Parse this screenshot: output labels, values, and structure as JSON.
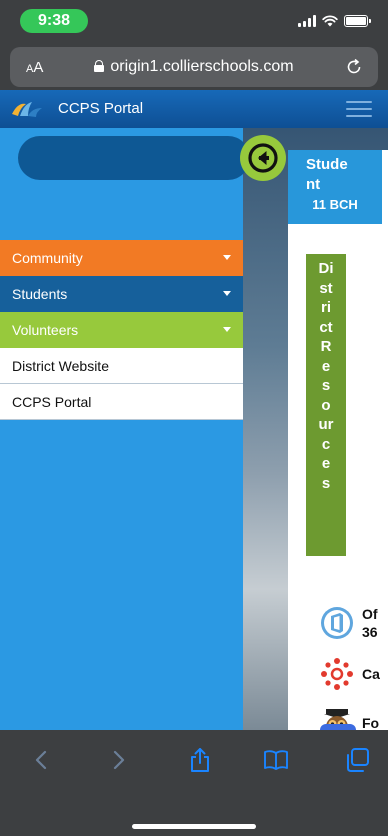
{
  "status_bar": {
    "time": "9:38"
  },
  "browser": {
    "aa_label_small": "A",
    "aa_label_large": "A",
    "url": "origin1.collierschools.com"
  },
  "portal": {
    "title": "CCPS Portal"
  },
  "sidebar": {
    "items": [
      {
        "label": "Community",
        "color": "#f27a24"
      },
      {
        "label": "Students",
        "color": "#16609b"
      },
      {
        "label": "Volunteers",
        "color": "#97c93c"
      },
      {
        "label": "District Website"
      },
      {
        "label": "CCPS Portal"
      }
    ]
  },
  "student_card": {
    "line1": "Stude",
    "line2": "nt",
    "grade": "11 BCH"
  },
  "district_resources": {
    "letters": [
      "Di",
      "st",
      "ri",
      "ct",
      "R",
      "e",
      "s",
      "o",
      "ur",
      "c",
      "e",
      "s"
    ]
  },
  "apps": [
    {
      "label_line1": "Of",
      "label_line2": "36",
      "icon": "office-365-icon"
    },
    {
      "label_line1": "Ca",
      "icon": "canvas-icon"
    },
    {
      "label_line1": "Fo",
      "icon": "focus-owl-icon"
    }
  ],
  "colors": {
    "header": "#1769b8",
    "sidebar": "#2b99e3",
    "accent_green": "#97c93c",
    "status_green": "#35c759"
  }
}
